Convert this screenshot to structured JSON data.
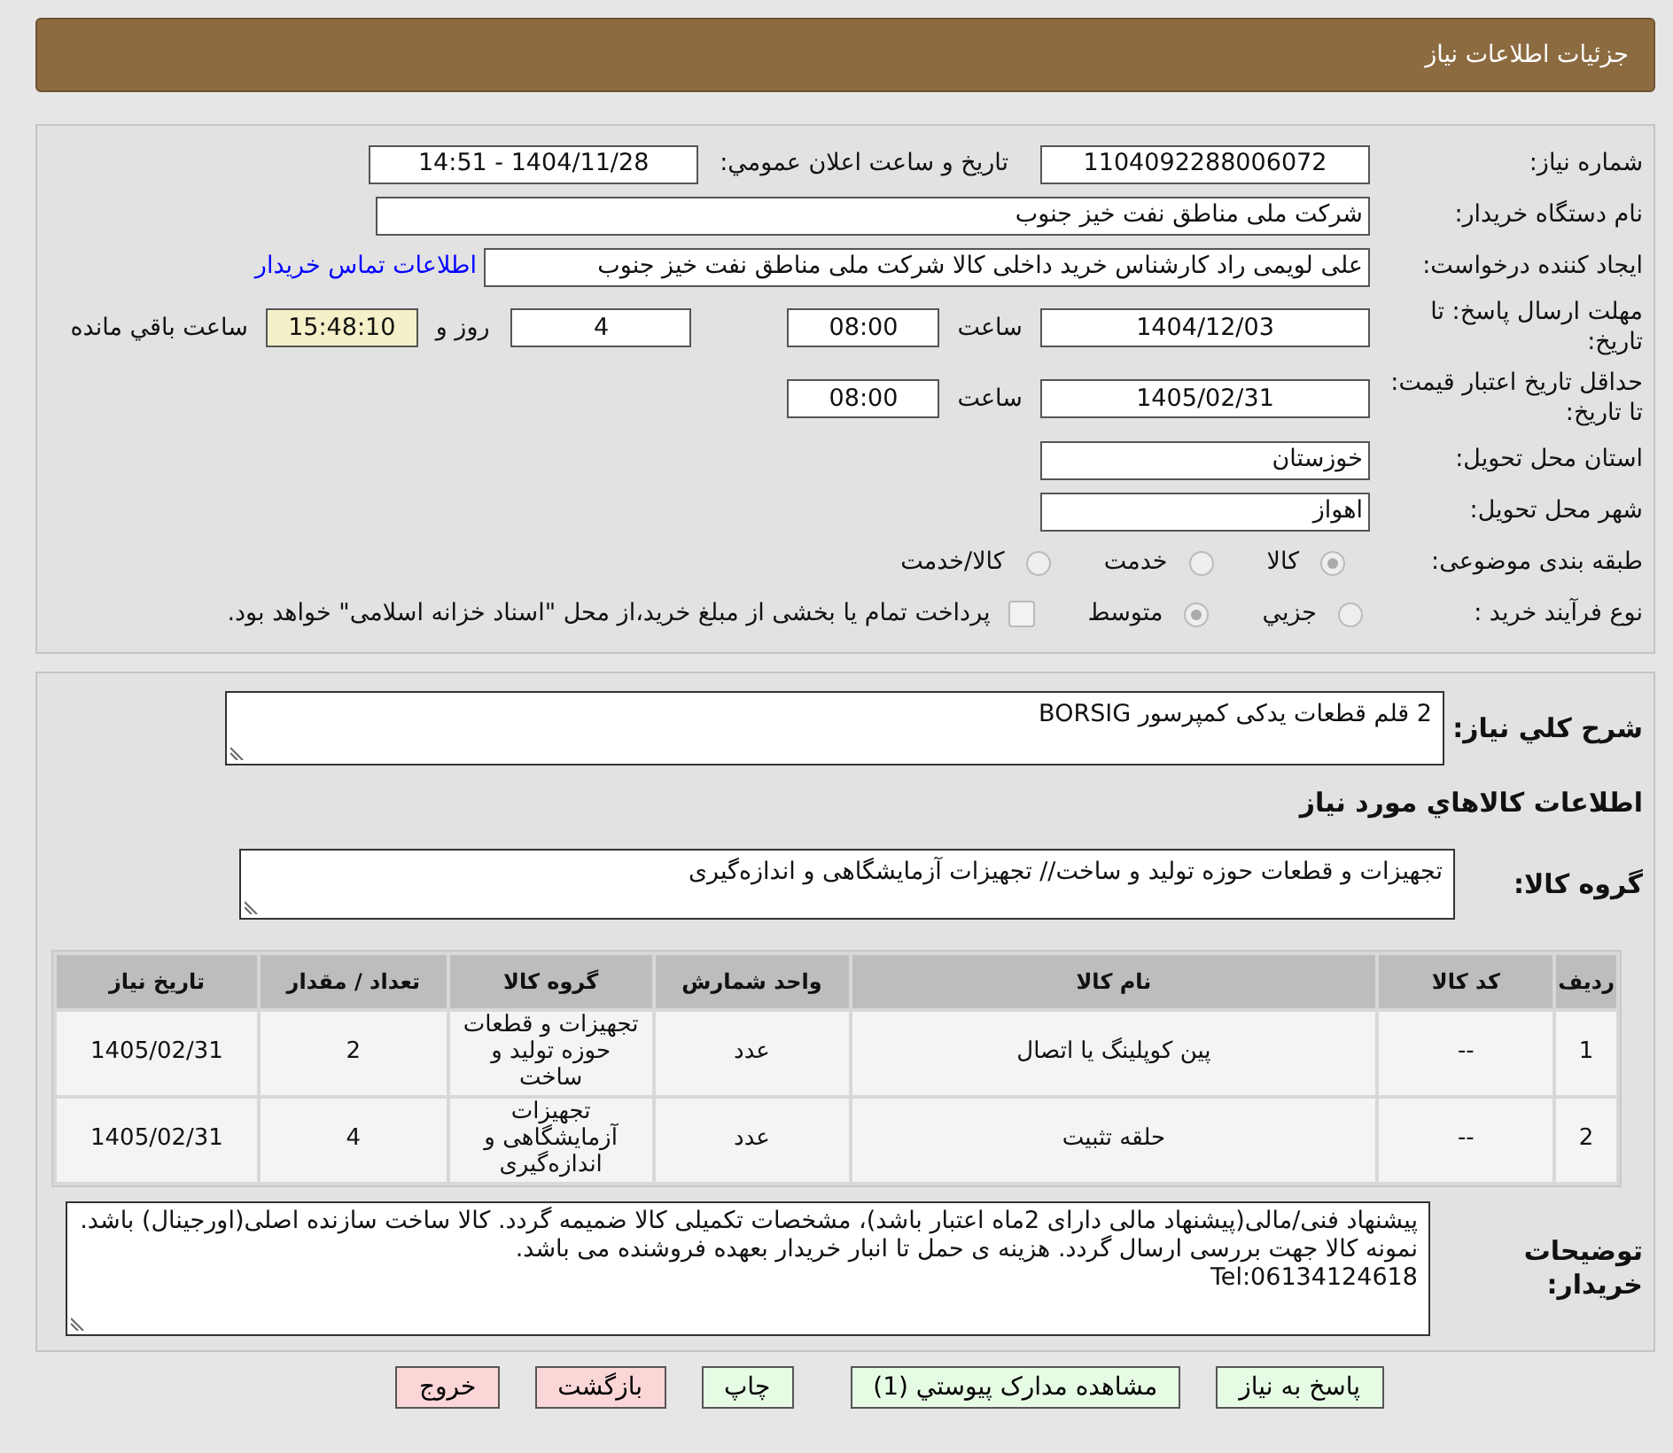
{
  "header": {
    "title": "جزئیات اطلاعات نیاز"
  },
  "need_number": {
    "label": "شماره نیاز:",
    "value": "1104092288006072"
  },
  "announce": {
    "label": "تاریخ و ساعت اعلان عمومي:",
    "value": "1404/11/28 - 14:51"
  },
  "buyer": {
    "label": "نام دستگاه خریدار:",
    "value": "شرکت ملی مناطق نفت خیز جنوب"
  },
  "requester": {
    "label": "ایجاد کننده درخواست:",
    "value": "علی  لویمی راد  کارشناس خرید داخلی کالا شرکت ملی مناطق نفت خیز جنوب",
    "link": "اطلاعات تماس خریدار"
  },
  "deadline": {
    "label": "مهلت ارسال پاسخ: تا تاریخ:",
    "date": "1404/12/03",
    "time_label": "ساعت",
    "time": "08:00",
    "days": "4",
    "days_suffix": "روز و",
    "remaining": "15:48:10",
    "remaining_suffix": "ساعت باقي مانده"
  },
  "validity": {
    "label": "حداقل تاریخ اعتبار قیمت: تا تاریخ:",
    "date": "1405/02/31",
    "time_label": "ساعت",
    "time": "08:00"
  },
  "province": {
    "label": "استان محل تحویل:",
    "value": "خوزستان"
  },
  "city": {
    "label": "شهر محل تحویل:",
    "value": "اهواز"
  },
  "category": {
    "label": "طبقه بندی موضوعی:",
    "options": [
      {
        "label": "کالا",
        "selected": true
      },
      {
        "label": "خدمت",
        "selected": false
      },
      {
        "label": "کالا/خدمت",
        "selected": false
      }
    ]
  },
  "purchase_type": {
    "label": "نوع فرآیند خرید :",
    "options": [
      {
        "label": "جزيي",
        "selected": false
      },
      {
        "label": "متوسط",
        "selected": true
      }
    ],
    "payment": {
      "checked": false,
      "label": "پرداخت تمام یا بخشی از مبلغ خرید،از محل \"اسناد خزانه اسلامی\" خواهد بود."
    }
  },
  "description": {
    "label": "شرح كلي نياز:",
    "value": "2 قلم قطعات یدکی کمپرسور BORSIG"
  },
  "items_title": "اطلاعات كالاهاي مورد نياز",
  "goods_group": {
    "label": "گروه کالا:",
    "value": "تجهیزات و قطعات حوزه تولید و ساخت// تجهیزات آزمایشگاهی و اندازه‌گیری"
  },
  "table": {
    "columns": [
      "ردیف",
      "کد کالا",
      "نام کالا",
      "واحد شمارش",
      "گروه کالا",
      "تعداد / مقدار",
      "تاریخ نیاز"
    ],
    "rows": [
      [
        "1",
        "--",
        "پین کوپلینگ یا اتصال",
        "عدد",
        "تجهیزات و قطعات حوزه تولید و ساخت",
        "2",
        "1405/02/31"
      ],
      [
        "2",
        "--",
        "حلقه تثبیت",
        "عدد",
        "تجهیزات آزمایشگاهی و اندازه‌گیری",
        "4",
        "1405/02/31"
      ]
    ]
  },
  "buyer_notes": {
    "label": "توضیحات خریدار:",
    "value": "پیشنهاد فنی/مالی(پیشنهاد مالی دارای 2ماه اعتبار باشد)، مشخصات تکمیلی کالا ضمیمه گردد. کالا ساخت سازنده اصلی(اورجینال) باشد. نمونه کالا جهت بررسی ارسال گردد. هزینه ی حمل تا انبار خریدار بعهده فروشنده می باشد.\nTel:06134124618"
  },
  "buttons": [
    {
      "label": "پاسخ به نیاز",
      "kind": "ok"
    },
    {
      "label": "مشاهده مدارک پیوستي (1)",
      "kind": "ok"
    },
    {
      "label": "چاپ",
      "kind": "ok"
    },
    {
      "label": "بازگشت",
      "kind": "danger"
    },
    {
      "label": "خروج",
      "kind": "danger"
    }
  ]
}
